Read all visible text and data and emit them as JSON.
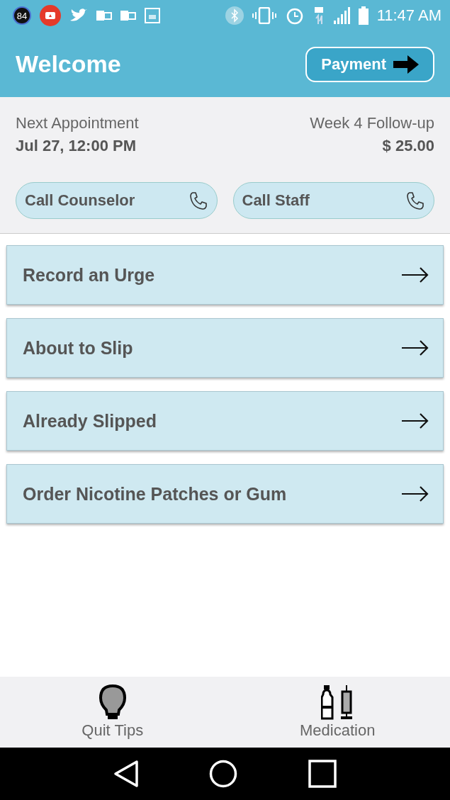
{
  "status_bar": {
    "badge": "84",
    "time": "11:47 AM"
  },
  "header": {
    "title": "Welcome",
    "payment_button": "Payment"
  },
  "appointment": {
    "label": "Next Appointment",
    "date": "Jul 27, 12:00 PM",
    "type": "Week 4 Follow-up",
    "price": "$ 25.00"
  },
  "call_buttons": [
    "Call Counselor",
    "Call Staff"
  ],
  "actions": [
    "Record an Urge",
    "About to Slip",
    "Already Slipped",
    "Order Nicotine Patches or Gum"
  ],
  "bottom_tabs": [
    {
      "label": "Quit Tips",
      "kind": "bulb"
    },
    {
      "label": "Medication",
      "kind": "medication"
    }
  ]
}
